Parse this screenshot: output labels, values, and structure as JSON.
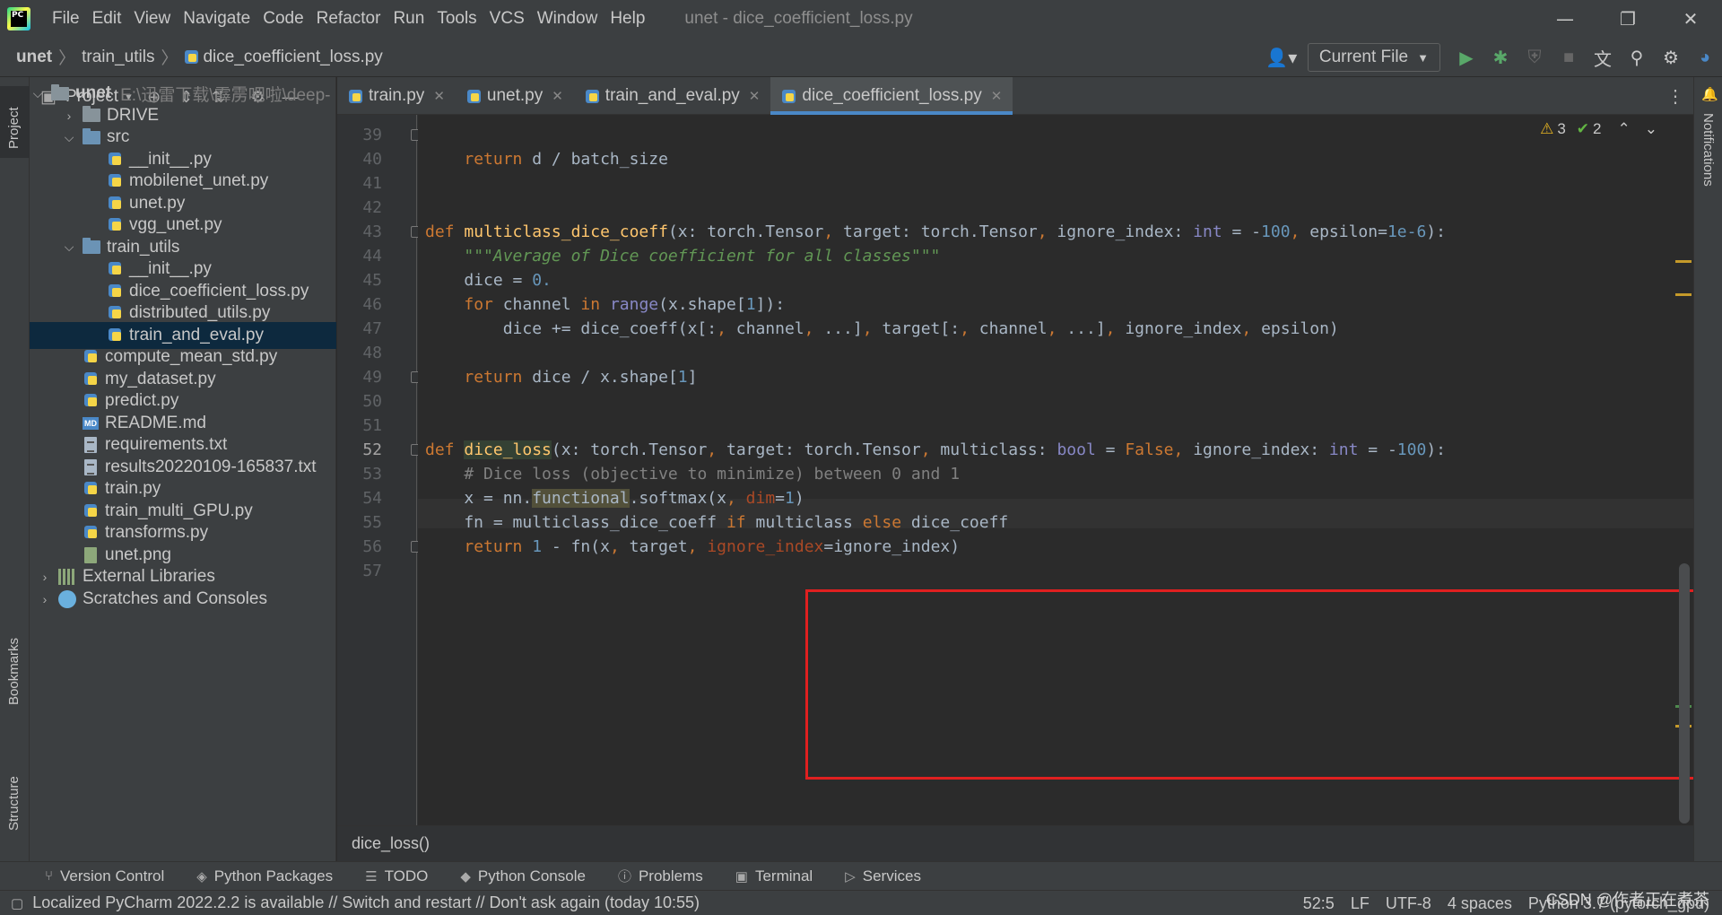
{
  "titlebar": {
    "menu": [
      "File",
      "Edit",
      "View",
      "Navigate",
      "Code",
      "Refactor",
      "Run",
      "Tools",
      "VCS",
      "Window",
      "Help"
    ],
    "window_title": "unet - dice_coefficient_loss.py"
  },
  "navbar": {
    "crumbs": [
      "unet",
      "train_utils",
      "dice_coefficient_loss.py"
    ],
    "run_config": "Current File"
  },
  "left_stripe": {
    "project": "Project",
    "bookmarks": "Bookmarks",
    "structure": "Structure"
  },
  "right_stripe": {
    "notifications": "Notifications"
  },
  "project_panel": {
    "title": "Project",
    "root_name": "unet",
    "root_path": "E:\\迅雷下载\\霹雳吧啦\\deep-",
    "items": [
      {
        "label": "DRIVE",
        "kind": "folder"
      },
      {
        "label": "src",
        "kind": "src"
      },
      {
        "label": "__init__.py",
        "kind": "py"
      },
      {
        "label": "mobilenet_unet.py",
        "kind": "py"
      },
      {
        "label": "unet.py",
        "kind": "py"
      },
      {
        "label": "vgg_unet.py",
        "kind": "py"
      },
      {
        "label": "train_utils",
        "kind": "src"
      },
      {
        "label": "__init__.py",
        "kind": "py"
      },
      {
        "label": "dice_coefficient_loss.py",
        "kind": "py"
      },
      {
        "label": "distributed_utils.py",
        "kind": "py"
      },
      {
        "label": "train_and_eval.py",
        "kind": "py"
      },
      {
        "label": "compute_mean_std.py",
        "kind": "py"
      },
      {
        "label": "my_dataset.py",
        "kind": "py"
      },
      {
        "label": "predict.py",
        "kind": "py"
      },
      {
        "label": "README.md",
        "kind": "md"
      },
      {
        "label": "requirements.txt",
        "kind": "txt"
      },
      {
        "label": "results20220109-165837.txt",
        "kind": "txt"
      },
      {
        "label": "train.py",
        "kind": "py"
      },
      {
        "label": "train_multi_GPU.py",
        "kind": "py"
      },
      {
        "label": "transforms.py",
        "kind": "py"
      },
      {
        "label": "unet.png",
        "kind": "img"
      },
      {
        "label": "External Libraries",
        "kind": "lib"
      },
      {
        "label": "Scratches and Consoles",
        "kind": "scr"
      }
    ]
  },
  "tabs": [
    {
      "label": "train.py",
      "active": false
    },
    {
      "label": "unet.py",
      "active": false
    },
    {
      "label": "train_and_eval.py",
      "active": false
    },
    {
      "label": "dice_coefficient_loss.py",
      "active": true
    }
  ],
  "editor": {
    "line_numbers": [
      "39",
      "40",
      "41",
      "42",
      "43",
      "44",
      "45",
      "46",
      "47",
      "48",
      "49",
      "50",
      "51",
      "52",
      "53",
      "54",
      "55",
      "56",
      "57"
    ],
    "current_line": "52",
    "warnings": "3",
    "weak_warnings": "2"
  },
  "code_breadcrumb": "dice_loss()",
  "tool_windows": [
    "Version Control",
    "Python Packages",
    "TODO",
    "Python Console",
    "Problems",
    "Terminal",
    "Services"
  ],
  "status": {
    "message": "Localized PyCharm 2022.2.2 is available // Switch and restart // Don't ask again (today 10:55)",
    "position": "52:5",
    "line_sep": "LF",
    "encoding": "UTF-8",
    "indent": "4 spaces",
    "interpreter": "Python 3.7 (pytorch_gpu)",
    "watermark": "CSDN @作者正在煮茶"
  },
  "colors": {
    "accent": "#4a88c7",
    "highlight_box": "#e02020",
    "selection": "#0d293e"
  }
}
